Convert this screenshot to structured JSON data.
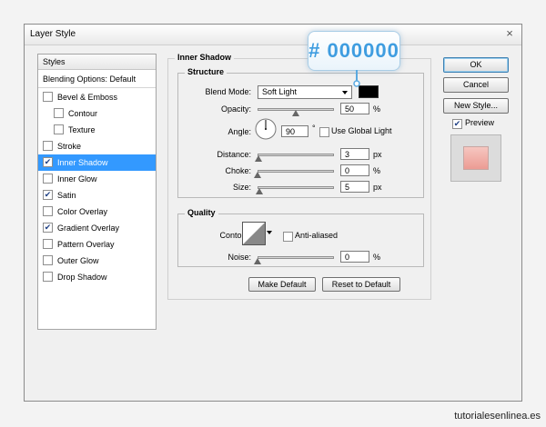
{
  "window": {
    "title": "Layer Style",
    "close_glyph": "×"
  },
  "styles_panel": {
    "header": "Styles",
    "blending_options": "Blending Options: Default",
    "items": [
      {
        "label": "Bevel & Emboss",
        "checked": false,
        "indent": false,
        "selected": false
      },
      {
        "label": "Contour",
        "checked": false,
        "indent": true,
        "selected": false
      },
      {
        "label": "Texture",
        "checked": false,
        "indent": true,
        "selected": false
      },
      {
        "label": "Stroke",
        "checked": false,
        "indent": false,
        "selected": false
      },
      {
        "label": "Inner Shadow",
        "checked": true,
        "indent": false,
        "selected": true
      },
      {
        "label": "Inner Glow",
        "checked": false,
        "indent": false,
        "selected": false
      },
      {
        "label": "Satin",
        "checked": true,
        "indent": false,
        "selected": false
      },
      {
        "label": "Color Overlay",
        "checked": false,
        "indent": false,
        "selected": false
      },
      {
        "label": "Gradient Overlay",
        "checked": true,
        "indent": false,
        "selected": false
      },
      {
        "label": "Pattern Overlay",
        "checked": false,
        "indent": false,
        "selected": false
      },
      {
        "label": "Outer Glow",
        "checked": false,
        "indent": false,
        "selected": false
      },
      {
        "label": "Drop Shadow",
        "checked": false,
        "indent": false,
        "selected": false
      }
    ]
  },
  "inner_shadow": {
    "section_title": "Inner Shadow",
    "structure": {
      "title": "Structure",
      "blend_mode_label": "Blend Mode:",
      "blend_mode_value": "Soft Light",
      "shadow_color": "#000000",
      "opacity_label": "Opacity:",
      "opacity_value": "50",
      "opacity_level": 50,
      "opacity_unit": "%",
      "angle_label": "Angle:",
      "angle_value": "90",
      "angle_unit": "°",
      "use_global_light_label": "Use Global Light",
      "use_global_light_checked": false,
      "distance_label": "Distance:",
      "distance_value": "3",
      "distance_level": 3,
      "distance_unit": "px",
      "choke_label": "Choke:",
      "choke_value": "0",
      "choke_level": 0,
      "choke_unit": "%",
      "size_label": "Size:",
      "size_value": "5",
      "size_level": 5,
      "size_unit": "px"
    },
    "quality": {
      "title": "Quality",
      "contour_label": "Contour:",
      "anti_aliased_label": "Anti-aliased",
      "anti_aliased_checked": false,
      "noise_label": "Noise:",
      "noise_value": "0",
      "noise_level": 0,
      "noise_unit": "%"
    },
    "make_default_label": "Make Default",
    "reset_default_label": "Reset to Default"
  },
  "buttons": {
    "ok": "OK",
    "cancel": "Cancel",
    "new_style": "New Style...",
    "preview_label": "Preview",
    "preview_checked": true
  },
  "preview_swatch": {
    "color_light": "#f6c6c0",
    "color_dark": "#ec9c94"
  },
  "callout": {
    "text": "# 000000",
    "color": "#3f9de0"
  },
  "watermark": "tutorialesenlinea.es"
}
